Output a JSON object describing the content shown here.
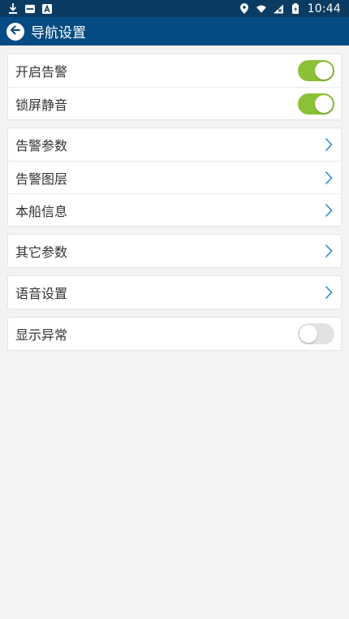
{
  "status_bar": {
    "left_icons": [
      "download-icon",
      "hms-icon",
      "a-icon"
    ],
    "right_icons": [
      "location-icon",
      "wifi-icon",
      "signal-icon",
      "battery-icon"
    ],
    "time": "10:44"
  },
  "header": {
    "title": "导航设置",
    "back_icon": "back-arrow-icon"
  },
  "groups": [
    {
      "items": [
        {
          "label": "开启告警",
          "type": "toggle",
          "checked": true
        },
        {
          "label": "锁屏静音",
          "type": "toggle",
          "checked": true
        }
      ]
    },
    {
      "items": [
        {
          "label": "告警参数",
          "type": "link",
          "icon": "chevron-right-icon"
        },
        {
          "label": "告警图层",
          "type": "link",
          "icon": "chevron-right-icon"
        },
        {
          "label": "本船信息",
          "type": "link",
          "icon": "chevron-right-icon"
        }
      ]
    },
    {
      "items": [
        {
          "label": "其它参数",
          "type": "link",
          "icon": "chevron-right-icon"
        }
      ]
    },
    {
      "items": [
        {
          "label": "语音设置",
          "type": "link",
          "icon": "chevron-right-icon"
        }
      ]
    },
    {
      "items": [
        {
          "label": "显示异常",
          "type": "toggle",
          "checked": false
        }
      ]
    }
  ],
  "colors": {
    "status_bar": "#0a3c63",
    "app_bar": "#064c84",
    "toggle_on": "#8bc136",
    "toggle_off": "#e2e2e2",
    "chevron": "#2a8fd6",
    "background": "#f3f3f3"
  }
}
